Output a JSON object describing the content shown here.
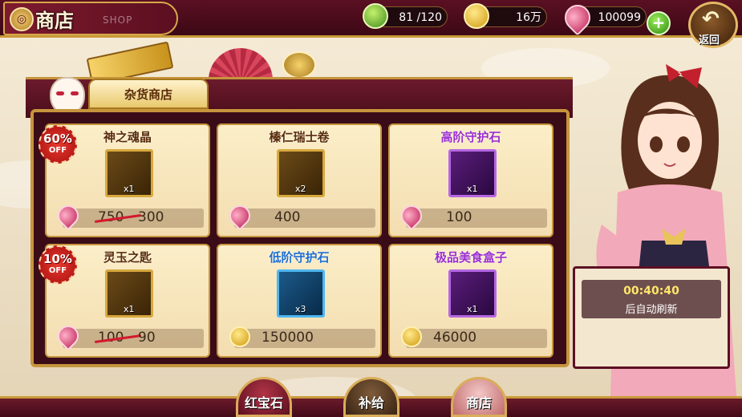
{
  "header": {
    "title": "商店",
    "subtitle": "SHOP",
    "stamina": "81  /120",
    "coins": "16万",
    "gems": "100099",
    "add_label": "+",
    "back_label": "返回"
  },
  "shop": {
    "tab_label": "杂货商店",
    "items": [
      {
        "name": "神之魂晶",
        "qty": "x1",
        "currency": "gem",
        "old_price": "750",
        "price": "300",
        "discount": "60%",
        "discount_off": "OFF",
        "name_color": "#5a2c0a"
      },
      {
        "name": "榛仁瑞士卷",
        "qty": "x2",
        "currency": "gem",
        "price": "400",
        "name_color": "#5a2c0a"
      },
      {
        "name": "高阶守护石",
        "qty": "x1",
        "currency": "gem",
        "price": "100",
        "name_color": "#9b2fd0"
      },
      {
        "name": "灵玉之匙",
        "qty": "x1",
        "currency": "gem",
        "old_price": "100",
        "price": "90",
        "discount": "10%",
        "discount_off": "OFF",
        "name_color": "#5a2c0a"
      },
      {
        "name": "低阶守护石",
        "qty": "x3",
        "currency": "coin",
        "price": "150000",
        "name_color": "#1f6fd1"
      },
      {
        "name": "极品美食盒子",
        "qty": "x1",
        "currency": "coin",
        "price": "46000",
        "name_color": "#9b2fd0"
      }
    ]
  },
  "refresh": {
    "timer": "00:40:40",
    "text": "后自动刷新"
  },
  "nav": {
    "gems_label": "红宝石",
    "supply_label": "补给",
    "shop_label": "商店"
  },
  "icons": [
    "stamina-icon",
    "coin-icon",
    "gem-icon",
    "plus-icon",
    "back-arrow-icon",
    "fox-mask-icon"
  ],
  "colors": {
    "accent_gold": "#c6953c",
    "panel_dark": "#3a0c18",
    "discount_red": "#d21a2c"
  }
}
